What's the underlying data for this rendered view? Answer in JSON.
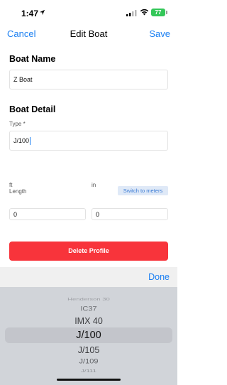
{
  "status_bar": {
    "time": "1:47",
    "battery": "77"
  },
  "nav": {
    "cancel_label": "Cancel",
    "title": "Edit Boat",
    "save_label": "Save"
  },
  "boat_name": {
    "heading": "Boat Name",
    "value": "Z Boat"
  },
  "boat_detail": {
    "heading": "Boat Detail",
    "type_label": "Type *",
    "type_value": "J/100"
  },
  "length": {
    "label": "Length",
    "switch_label": "Switch to meters",
    "ft_label": "ft",
    "ft_value": "0",
    "in_label": "in",
    "in_value": "0"
  },
  "delete_label": "Delete Profile",
  "picker": {
    "done_label": "Done",
    "items": [
      "Henderson 30",
      "IC37",
      "IMX 40",
      "J/100",
      "J/105",
      "J/109",
      "J/111"
    ],
    "selected": "J/100"
  },
  "colors": {
    "accent": "#1a7ff2",
    "danger": "#f8343b",
    "battery": "#34c759"
  }
}
